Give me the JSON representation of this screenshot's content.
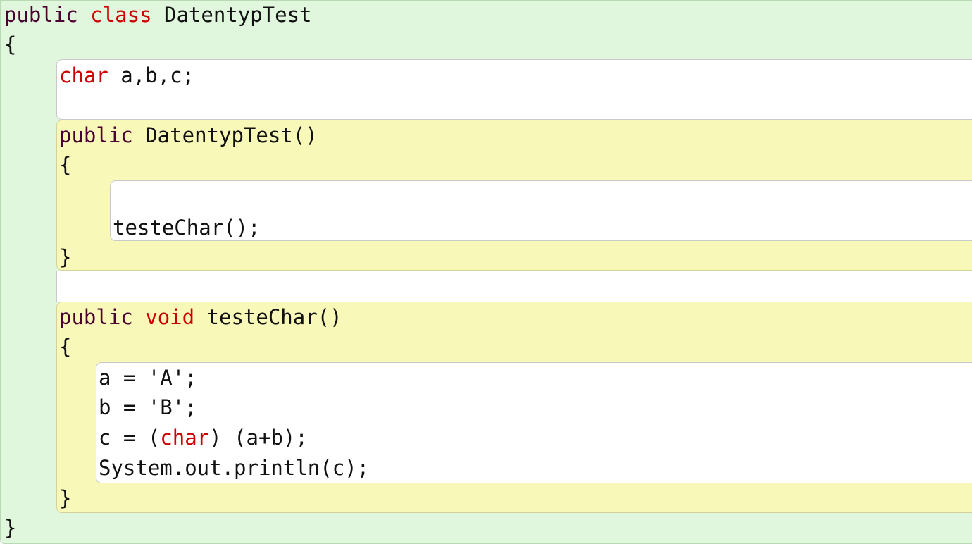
{
  "code": {
    "class_kw_public": "public",
    "class_kw_class": "class",
    "class_name": " DatentypTest",
    "open_class": "{",
    "field_kw_char": "char",
    "field_rest": " a,b,c;",
    "ctor_kw_public": "public",
    "ctor_rest": " DatentypTest()",
    "ctor_open": "{",
    "ctor_call": "testeChar();",
    "ctor_close": "}",
    "method_kw_public": "public",
    "method_kw_void": "void",
    "method_rest": " testeChar()",
    "method_open": "{",
    "stmt_a": "a = 'A';",
    "stmt_b": "b = 'B';",
    "stmt_c_pre": "c = (",
    "stmt_c_kw": "char",
    "stmt_c_post": ") (a+b);",
    "stmt_print": "System.out.println(c);",
    "method_close": "}",
    "close_class": "}"
  },
  "colors": {
    "class_scope": "#e0f7dd",
    "method_scope": "#f8f8b8",
    "body": "#ffffff",
    "keyword_red": "#cc0000",
    "keyword_purple": "#4a0030"
  }
}
